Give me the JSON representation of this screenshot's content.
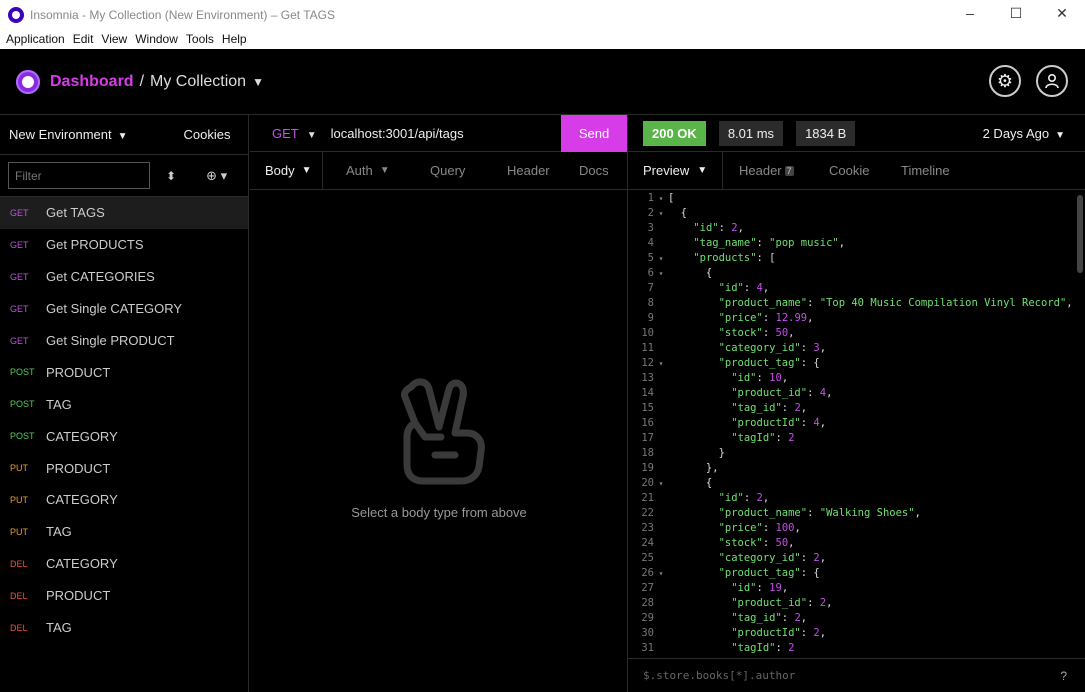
{
  "window": {
    "title": "Insomnia - My Collection (New Environment) – Get TAGS",
    "controls": [
      "–",
      "☐",
      "✕"
    ]
  },
  "menu": [
    "Application",
    "Edit",
    "View",
    "Window",
    "Tools",
    "Help"
  ],
  "header": {
    "dashboard": "Dashboard",
    "separator": "/",
    "collection": "My Collection",
    "settings_icon": "gear-icon",
    "account_icon": "user-icon"
  },
  "sidebar": {
    "environment": "New Environment",
    "cookies": "Cookies",
    "filter_placeholder": "Filter",
    "requests": [
      {
        "method": "GET",
        "name": "Get TAGS",
        "active": true
      },
      {
        "method": "GET",
        "name": "Get PRODUCTS"
      },
      {
        "method": "GET",
        "name": "Get CATEGORIES"
      },
      {
        "method": "GET",
        "name": "Get Single CATEGORY"
      },
      {
        "method": "GET",
        "name": "Get Single PRODUCT"
      },
      {
        "method": "POST",
        "name": "PRODUCT"
      },
      {
        "method": "POST",
        "name": "TAG"
      },
      {
        "method": "POST",
        "name": "CATEGORY"
      },
      {
        "method": "PUT",
        "name": "PRODUCT"
      },
      {
        "method": "PUT",
        "name": "CATEGORY"
      },
      {
        "method": "PUT",
        "name": "TAG"
      },
      {
        "method": "DEL",
        "name": "CATEGORY"
      },
      {
        "method": "DEL",
        "name": "PRODUCT"
      },
      {
        "method": "DEL",
        "name": "TAG"
      }
    ]
  },
  "request": {
    "method": "GET",
    "url": "localhost:3001/api/tags",
    "send": "Send",
    "tabs": [
      "Body",
      "Auth",
      "Query",
      "Header",
      "Docs"
    ],
    "empty_message": "Select a body type from above"
  },
  "response": {
    "status": "200 OK",
    "time": "8.01 ms",
    "size": "1834 B",
    "ago": "2 Days Ago",
    "tabs": [
      "Preview",
      "Header",
      "Cookie",
      "Timeline"
    ],
    "header_count": "7",
    "filter_placeholder": "$.store.books[*].author",
    "help": "?",
    "lines": [
      "[",
      "  {",
      "    \"id\": 2,",
      "    \"tag_name\": \"pop music\",",
      "    \"products\": [",
      "      {",
      "        \"id\": 4,",
      "        \"product_name\": \"Top 40 Music Compilation Vinyl Record\",",
      "        \"price\": 12.99,",
      "        \"stock\": 50,",
      "        \"category_id\": 3,",
      "        \"product_tag\": {",
      "          \"id\": 10,",
      "          \"product_id\": 4,",
      "          \"tag_id\": 2,",
      "          \"productId\": 4,",
      "          \"tagId\": 2",
      "        }",
      "      },",
      "      {",
      "        \"id\": 2,",
      "        \"product_name\": \"Walking Shoes\",",
      "        \"price\": 100,",
      "        \"stock\": 50,",
      "        \"category_id\": 2,",
      "        \"product_tag\": {",
      "          \"id\": 19,",
      "          \"product_id\": 2,",
      "          \"tag_id\": 2,",
      "          \"productId\": 2,",
      "          \"tagId\": 2"
    ],
    "fold_lines": [
      1,
      2,
      5,
      6,
      12,
      20,
      26
    ]
  }
}
